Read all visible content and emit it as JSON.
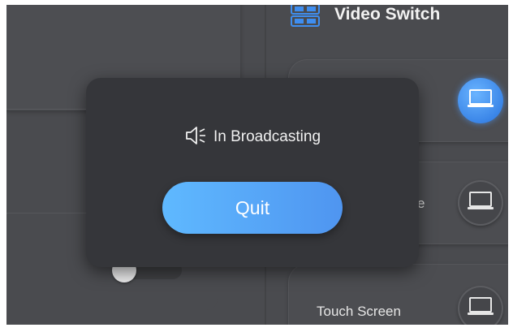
{
  "video_switch": {
    "title": "Video Switch",
    "icon": "video-switch-icon"
  },
  "sources": [
    {
      "label": "",
      "icon": "laptop-icon",
      "active": true
    },
    {
      "label": "e",
      "icon": "laptop-icon",
      "active": false
    },
    {
      "label": "Touch Screen",
      "icon": "laptop-icon",
      "active": false
    }
  ],
  "dialog": {
    "status_icon": "speaker-icon",
    "status_text": "In Broadcasting",
    "quit_label": "Quit"
  },
  "colors": {
    "background": "#4a4b4f",
    "dialog": "#35363a",
    "accent_start": "#5fb9ff",
    "accent_end": "#4f95f0"
  }
}
